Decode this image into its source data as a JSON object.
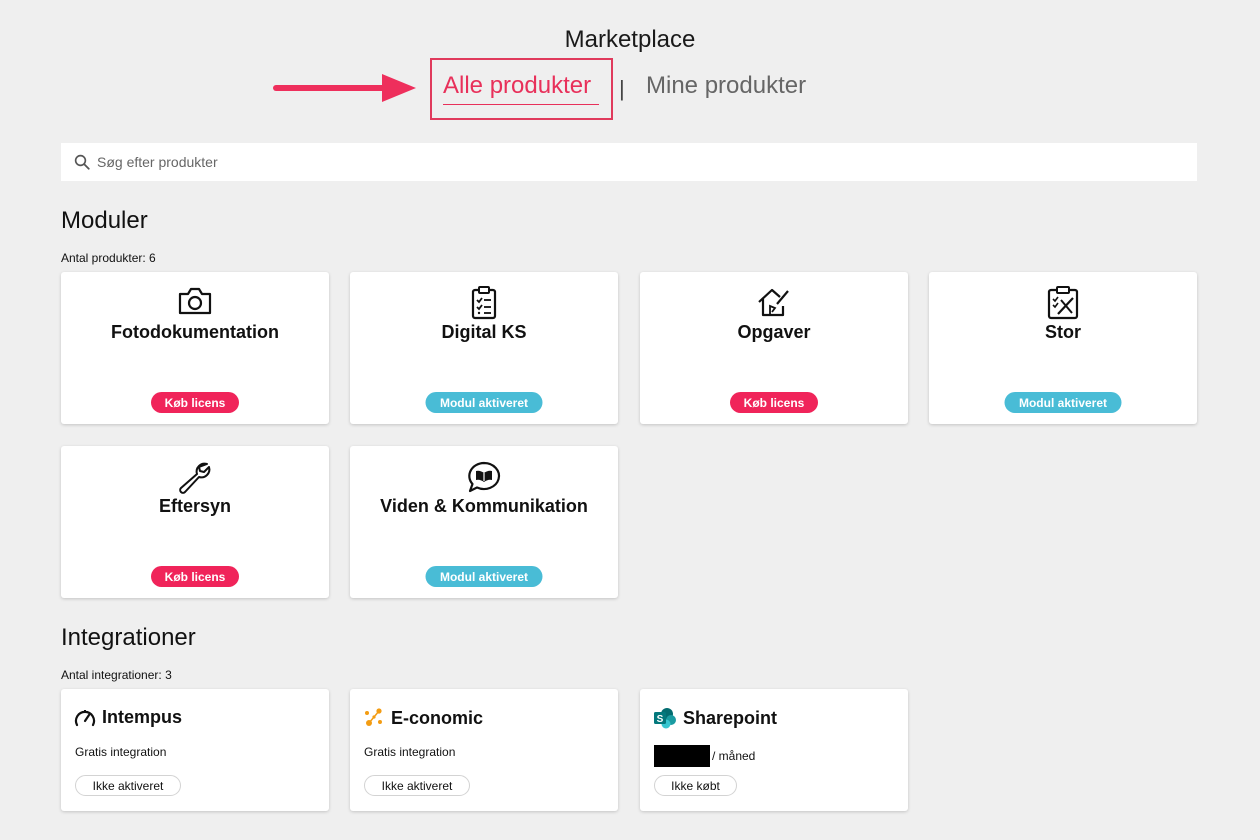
{
  "header": {
    "title": "Marketplace"
  },
  "tabs": {
    "active": "Alle produkter",
    "separator": "|",
    "inactive": "Mine produkter"
  },
  "search": {
    "placeholder": "Søg efter produkter"
  },
  "modules": {
    "heading": "Moduler",
    "count": "Antal produkter: 6",
    "items": [
      {
        "name": "Fotodokumentation",
        "icon": "camera-icon",
        "status": "Køb licens",
        "status_color": "#f0245a"
      },
      {
        "name": "Digital KS",
        "icon": "clipboard-checklist-icon",
        "status": "Modul aktiveret",
        "status_color": "#49bcd6"
      },
      {
        "name": "Opgaver",
        "icon": "house-pencil-icon",
        "status": "Køb licens",
        "status_color": "#f0245a"
      },
      {
        "name": "Stor",
        "icon": "clipboard-tools-icon",
        "status": "Modul aktiveret",
        "status_color": "#49bcd6"
      },
      {
        "name": "Eftersyn",
        "icon": "wrench-icon",
        "status": "Køb licens",
        "status_color": "#f0245a"
      },
      {
        "name": "Viden & Kommunikation",
        "icon": "chat-book-icon",
        "status": "Modul aktiveret",
        "status_color": "#49bcd6"
      }
    ]
  },
  "integrations": {
    "heading": "Integrationer",
    "count": "Antal integrationer: 3",
    "items": [
      {
        "name": "Intempus",
        "icon": "gauge-icon",
        "price": "Gratis integration",
        "status": "Ikke aktiveret"
      },
      {
        "name": "E-conomic",
        "icon": "economic-logo-icon",
        "price": "Gratis integration",
        "status": "Ikke aktiveret"
      },
      {
        "name": "Sharepoint",
        "icon": "sharepoint-logo-icon",
        "price": "/ måned",
        "status": "Ikke købt"
      }
    ]
  },
  "colors": {
    "accent": "#e8305a",
    "active_badge": "#49bcd6",
    "buy_badge": "#f0245a",
    "background": "#efefef"
  }
}
